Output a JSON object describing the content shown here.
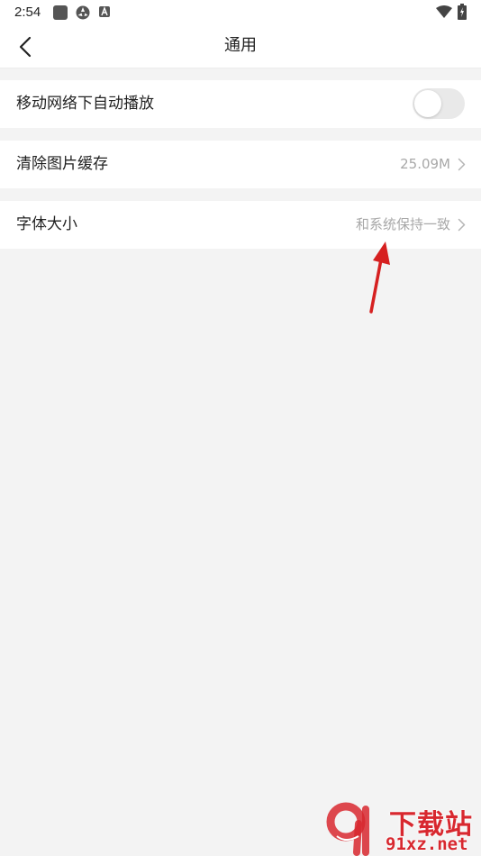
{
  "status_bar": {
    "time": "2:54",
    "icons": [
      "app-square-icon",
      "gear-icon",
      "a-notification-icon",
      "wifi-icon",
      "battery-charging-icon"
    ]
  },
  "header": {
    "title": "通用",
    "back_icon": "back-arrow-icon"
  },
  "settings": {
    "mobile_autoplay": {
      "label": "移动网络下自动播放",
      "enabled": false
    },
    "clear_cache": {
      "label": "清除图片缓存",
      "value": "25.09M"
    },
    "font_size": {
      "label": "字体大小",
      "value": "和系统保持一致"
    }
  },
  "watermark": {
    "title": "下载站",
    "url": "91xz.net"
  },
  "colors": {
    "accent_red": "#d8282f",
    "background": "#f3f3f3",
    "value_text": "#a8a8a8"
  }
}
